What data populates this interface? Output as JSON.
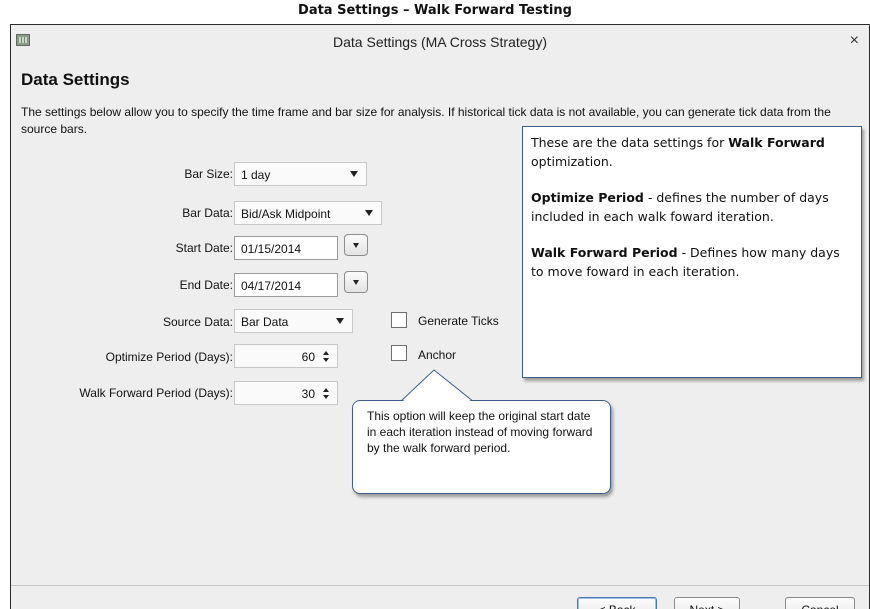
{
  "caption": "Data Settings – Walk Forward Testing",
  "window": {
    "title": "Data Settings (MA Cross Strategy)",
    "icon": "app-icon",
    "close_glyph": "×"
  },
  "page": {
    "title": "Data Settings",
    "description": "The settings below allow you to specify the time frame and bar size for analysis. If historical tick data is not available, you can generate tick data from the source bars."
  },
  "form": {
    "bar_size": {
      "label": "Bar Size:",
      "value": "1 day"
    },
    "bar_data": {
      "label": "Bar Data:",
      "value": "Bid/Ask Midpoint"
    },
    "start_date": {
      "label": "Start Date:",
      "value": "01/15/2014"
    },
    "end_date": {
      "label": "End Date:",
      "value": "04/17/2014"
    },
    "source_data": {
      "label": "Source Data:",
      "value": "Bar Data"
    },
    "optimize_period": {
      "label": "Optimize Period (Days):",
      "value": "60"
    },
    "walk_forward_period": {
      "label": "Walk Forward Period (Days):",
      "value": "30"
    },
    "generate_ticks": {
      "label": "Generate Ticks",
      "checked": false
    },
    "anchor": {
      "label": "Anchor",
      "checked": false
    }
  },
  "callout": {
    "intro_prefix": "These are the data settings for ",
    "intro_bold": "Walk Forward",
    "intro_suffix": " optimization.",
    "optimize_term": "Optimize Period",
    "optimize_desc": " - defines the number of days included in each walk foward iteration.",
    "walk_term": "Walk Forward Period",
    "walk_desc": " - Defines how many days to move foward in each iteration."
  },
  "tooltip": {
    "text": "This option will keep the original start date in each iteration instead of moving forward by the walk forward period."
  },
  "buttons": {
    "back": "< Back",
    "next": "Next >",
    "cancel": "Cancel"
  }
}
